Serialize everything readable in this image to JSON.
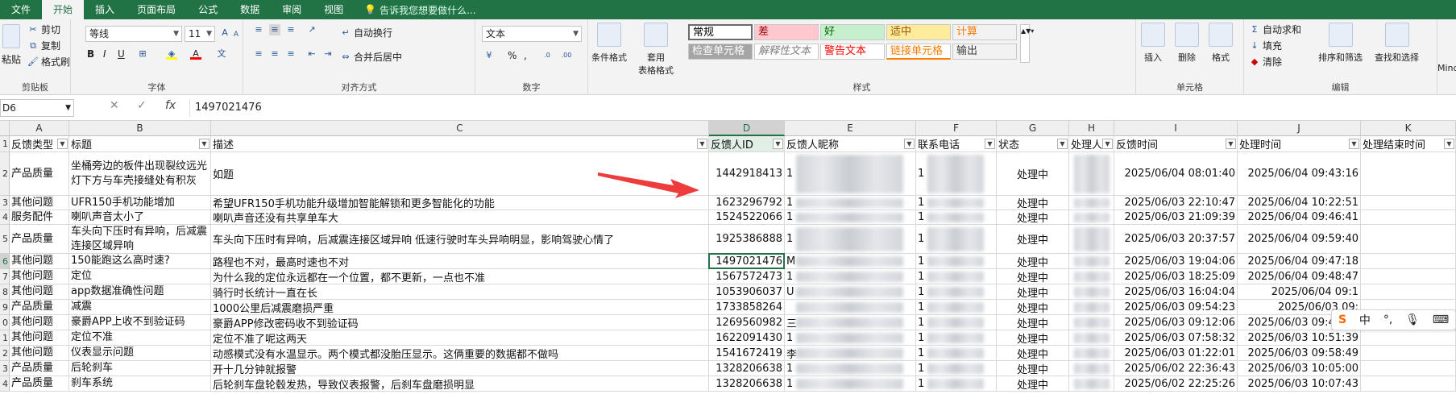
{
  "tabs": [
    "文件",
    "开始",
    "插入",
    "页面布局",
    "公式",
    "数据",
    "审阅",
    "视图"
  ],
  "active_tab": "开始",
  "tell_me": "告诉我您想要做什么...",
  "ribbon": {
    "clipboard": {
      "paste": "粘贴",
      "cut": "剪切",
      "copy": "复制",
      "format_painter": "格式刷",
      "label": "剪贴板"
    },
    "font": {
      "name": "等线",
      "size": "11",
      "bold": "B",
      "italic": "I",
      "underline": "U",
      "label": "字体"
    },
    "alignment": {
      "wrap": "自动换行",
      "merge": "合并后居中",
      "label": "对齐方式"
    },
    "number": {
      "format": "文本",
      "percent": "%",
      "comma": ",",
      "label": "数字"
    },
    "styles": {
      "cond_format": "条件格式",
      "table_format": "套用\n表格格式",
      "cells": [
        {
          "text": "常规",
          "color": "#000000",
          "bg": "#ffffff"
        },
        {
          "text": "差",
          "color": "#9c0006",
          "bg": "#ffc7ce"
        },
        {
          "text": "好",
          "color": "#006100",
          "bg": "#c6efce"
        },
        {
          "text": "适中",
          "color": "#9c5700",
          "bg": "#ffeb9c"
        },
        {
          "text": "计算",
          "color": "#fa7d00",
          "bg": "#f2f2f2"
        },
        {
          "text": "检查单元格",
          "color": "#ffffff",
          "bg": "#a5a5a5"
        },
        {
          "text": "解释性文本",
          "color": "#7f7f7f",
          "bg": "#ffffff"
        },
        {
          "text": "警告文本",
          "color": "#ff0000",
          "bg": "#ffffff"
        },
        {
          "text": "链接单元格",
          "color": "#fa7d00",
          "bg": "#ffffff"
        },
        {
          "text": "输出",
          "color": "#3f3f3f",
          "bg": "#f2f2f2"
        }
      ],
      "label": "样式"
    },
    "cells_group": {
      "insert": "插入",
      "delete": "删除",
      "format": "格式",
      "label": "单元格"
    },
    "editing": {
      "autosum": "自动求和",
      "fill": "填充",
      "clear": "清除",
      "sort": "排序和筛选",
      "find": "查找和选择",
      "label": "编辑"
    },
    "mind": "Mind"
  },
  "formula_bar": {
    "name_box": "D6",
    "fx": "fx",
    "content": "1497021476"
  },
  "columns": [
    {
      "letter": "A",
      "header": "反馈类型"
    },
    {
      "letter": "B",
      "header": "标题"
    },
    {
      "letter": "C",
      "header": "描述"
    },
    {
      "letter": "D",
      "header": "反馈人ID"
    },
    {
      "letter": "E",
      "header": "反馈人昵称"
    },
    {
      "letter": "F",
      "header": "联系电话"
    },
    {
      "letter": "G",
      "header": "状态"
    },
    {
      "letter": "H",
      "header": "处理人"
    },
    {
      "letter": "I",
      "header": "反馈时间"
    },
    {
      "letter": "J",
      "header": "处理时间"
    },
    {
      "letter": "K",
      "header": "处理结束时间"
    }
  ],
  "rows": [
    {
      "n": "2",
      "a": "产品质量",
      "b": "坐桶旁边的板件出现裂纹远光灯下方与车壳接缝处有积灰",
      "c": "如题",
      "d": "1442918413",
      "e": "1",
      "f": "1",
      "g": "处理中",
      "i": "2025/06/04 08:01:40",
      "j": "2025/06/04 09:43:16"
    },
    {
      "n": "3",
      "a": "其他问题",
      "b": "UFR150手机功能增加",
      "c": "希望UFR150手机功能升级增加智能解锁和更多智能化的功能",
      "d": "1623296792",
      "e": "1",
      "f": "1",
      "g": "处理中",
      "i": "2025/06/03 22:10:47",
      "j": "2025/06/04 10:22:51"
    },
    {
      "n": "4",
      "a": "服务配件",
      "b": "喇叭声音太小了",
      "c": "喇叭声音还没有共享单车大",
      "d": "1524522066",
      "e": "1",
      "f": "1",
      "g": "处理中",
      "i": "2025/06/03 21:09:39",
      "j": "2025/06/04 09:46:41"
    },
    {
      "n": "5",
      "a": "产品质量",
      "b": "车头向下压时有异响，后减震连接区域异响",
      "c": "车头向下压时有异响，后减震连接区域异响 低速行驶时车头异响明显，影响驾驶心情了",
      "d": "1925386888",
      "e": "1",
      "f": "1",
      "g": "处理中",
      "i": "2025/06/03 20:37:57",
      "j": "2025/06/04 09:59:40"
    },
    {
      "n": "6",
      "a": "其他问题",
      "b": "150能跑这么高时速?",
      "c": "路程也不对，最高时速也不对",
      "d": "1497021476",
      "e": "M",
      "f": "1",
      "g": "处理中",
      "i": "2025/06/03 19:04:06",
      "j": "2025/06/04 09:47:18"
    },
    {
      "n": "7",
      "a": "其他问题",
      "b": "定位",
      "c": "为什么我的定位永远都在一个位置，都不更新，一点也不准",
      "d": "1567572473",
      "e": "1",
      "f": "1",
      "g": "处理中",
      "i": "2025/06/03 18:25:09",
      "j": "2025/06/04 09:48:47"
    },
    {
      "n": "8",
      "a": "其他问题",
      "b": "app数据准确性问题",
      "c": "骑行时长统计一直在长",
      "d": "1053906037",
      "e": "U",
      "f": "1",
      "g": "处理中",
      "i": "2025/06/03 16:04:04",
      "j": "2025/06/04 09:1"
    },
    {
      "n": "9",
      "a": "产品质量",
      "b": "减震",
      "c": "1000公里后减震磨损严重",
      "d": "1733858264",
      "e": "",
      "f": "1",
      "g": "处理中",
      "i": "2025/06/03 09:54:23",
      "j": "2025/06/03 09:"
    },
    {
      "n": "0",
      "a": "其他问题",
      "b": "豪爵APP上收不到验证码",
      "c": "豪爵APP修改密码收不到验证码",
      "d": "1269560982",
      "e": "三",
      "f": "1",
      "g": "处理中",
      "i": "2025/06/03 09:12:06",
      "j": "2025/06/03 09:47:40"
    },
    {
      "n": "1",
      "a": "其他问题",
      "b": "定位不准",
      "c": "定位不准了呢这两天",
      "d": "1622091430",
      "e": "1",
      "f": "1",
      "g": "处理中",
      "i": "2025/06/03 07:58:32",
      "j": "2025/06/03 10:51:39"
    },
    {
      "n": "2",
      "a": "其他问题",
      "b": "仪表显示问题",
      "c": "动感模式没有水温显示。两个模式都没胎压显示。这俩重要的数据都不做吗",
      "d": "1541672419",
      "e": "李",
      "f": "1",
      "g": "处理中",
      "i": "2025/06/03 01:22:01",
      "j": "2025/06/03 09:58:49"
    },
    {
      "n": "3",
      "a": "产品质量",
      "b": "后轮刹车",
      "c": "开十几分钟就报警",
      "d": "1328206638",
      "e": "1",
      "f": "1",
      "g": "处理中",
      "i": "2025/06/02 22:36:43",
      "j": "2025/06/03 10:05:00"
    },
    {
      "n": "4",
      "a": "产品质量",
      "b": "刹车系统",
      "c": "后轮刹车盘轮毂发热，导致仪表报警，后刹车盘磨损明显",
      "d": "1328206638",
      "e": "1",
      "f": "1",
      "g": "处理中",
      "i": "2025/06/02 22:25:26",
      "j": "2025/06/03 10:07:43"
    }
  ],
  "ime": {
    "logo": "S",
    "lang": "中",
    "punct": "°,"
  }
}
